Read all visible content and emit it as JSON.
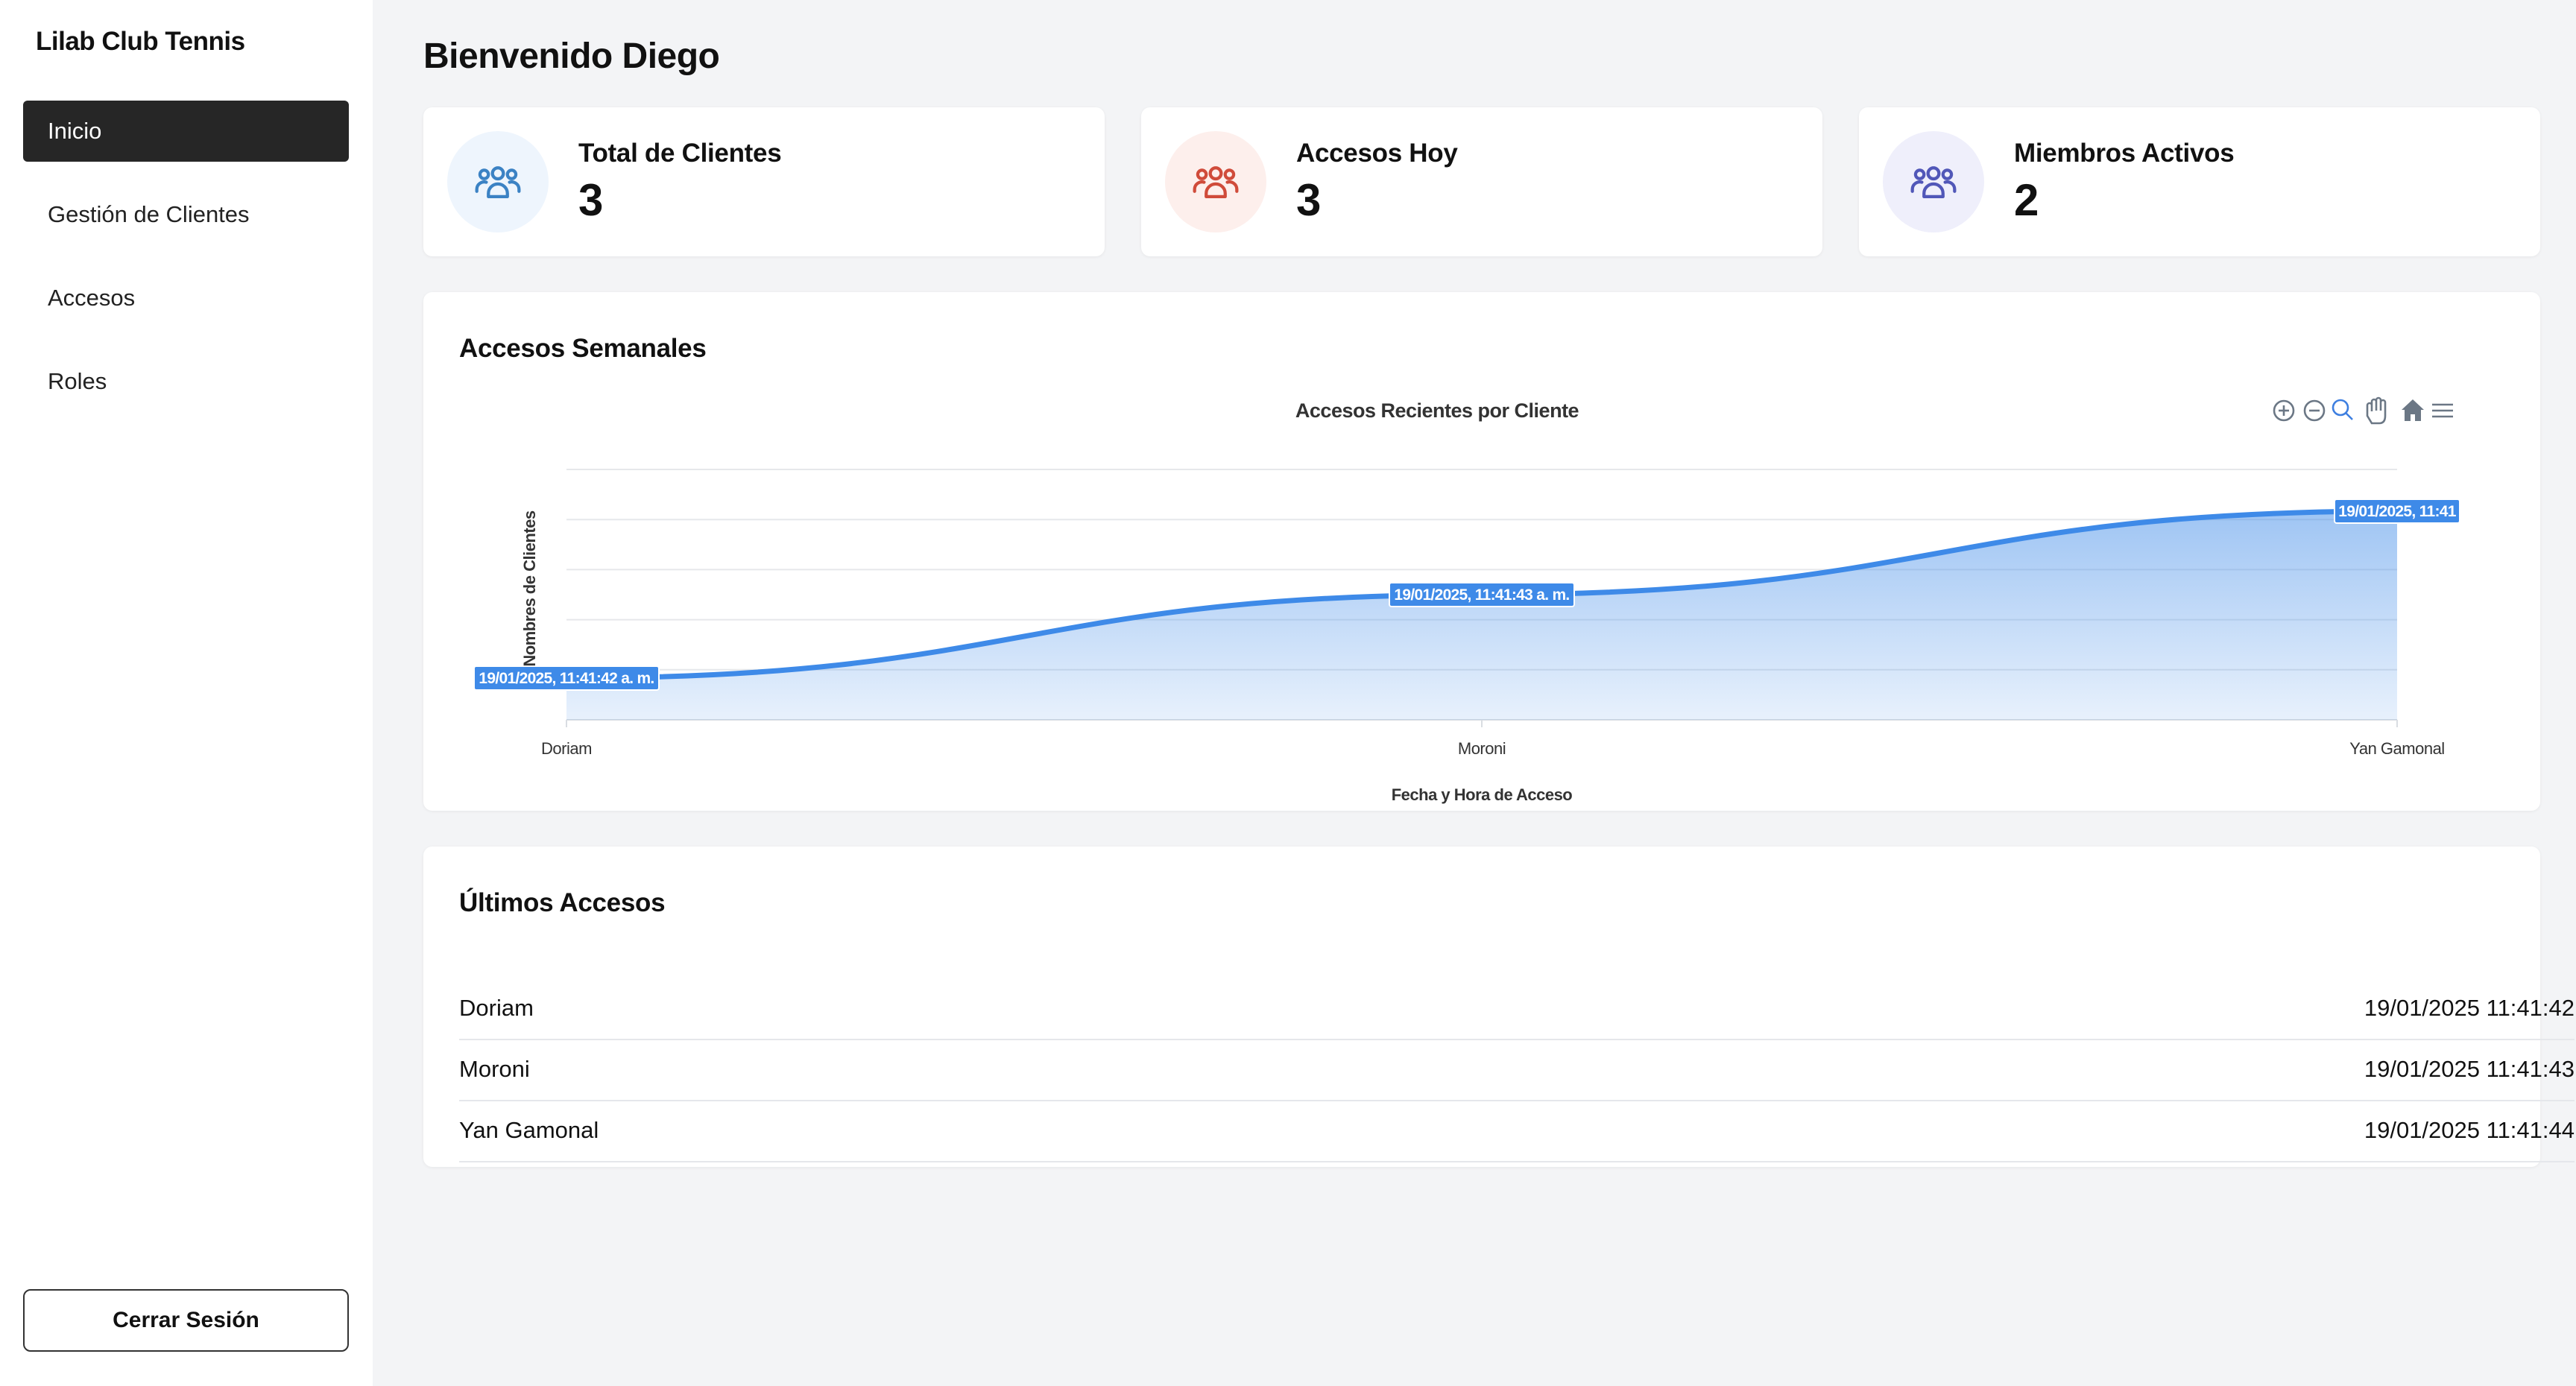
{
  "app": {
    "title": "Lilab Club Tennis"
  },
  "sidebar": {
    "items": [
      {
        "label": "Inicio",
        "active": true
      },
      {
        "label": "Gestión de Clientes",
        "active": false
      },
      {
        "label": "Accesos",
        "active": false
      },
      {
        "label": "Roles",
        "active": false
      }
    ],
    "logout_label": "Cerrar Sesión"
  },
  "header": {
    "welcome": "Bienvenido Diego"
  },
  "stats": [
    {
      "label": "Total de Clientes",
      "value": "3",
      "icon": "users-icon",
      "color": "#3b82c4",
      "bg": "#eef5fd"
    },
    {
      "label": "Accesos Hoy",
      "value": "3",
      "icon": "users-icon",
      "color": "#d04b3a",
      "bg": "#fdefec"
    },
    {
      "label": "Miembros Activos",
      "value": "2",
      "icon": "users-icon",
      "color": "#5157b8",
      "bg": "#efeffb"
    }
  ],
  "weekly": {
    "title": "Accesos Semanales"
  },
  "chart_data": {
    "type": "area",
    "title": "Accesos Recientes por Cliente",
    "xlabel": "Fecha y Hora de Acceso",
    "ylabel": "Nombres de Clientes",
    "categories": [
      "Doriam",
      "Moroni",
      "Yan Gamonal"
    ],
    "series": [
      {
        "values": [
          1,
          2,
          3
        ]
      }
    ],
    "ylim": [
      0.5,
      3.5
    ],
    "data_labels": [
      "19/01/2025, 11:41:42 a. m.",
      "19/01/2025, 11:41:43 a. m.",
      "19/01/2025, 11:41"
    ],
    "grid": true,
    "line_color": "#3e8ae8",
    "toolbar": [
      "zoom-in-icon",
      "zoom-out-icon",
      "search-icon",
      "pan-hand-icon",
      "home-icon",
      "menu-icon"
    ]
  },
  "recent": {
    "title": "Últimos Accesos",
    "rows": [
      {
        "name": "Doriam",
        "time": "19/01/2025 11:41:42"
      },
      {
        "name": "Moroni",
        "time": "19/01/2025 11:41:43"
      },
      {
        "name": "Yan Gamonal",
        "time": "19/01/2025 11:41:44"
      }
    ]
  }
}
